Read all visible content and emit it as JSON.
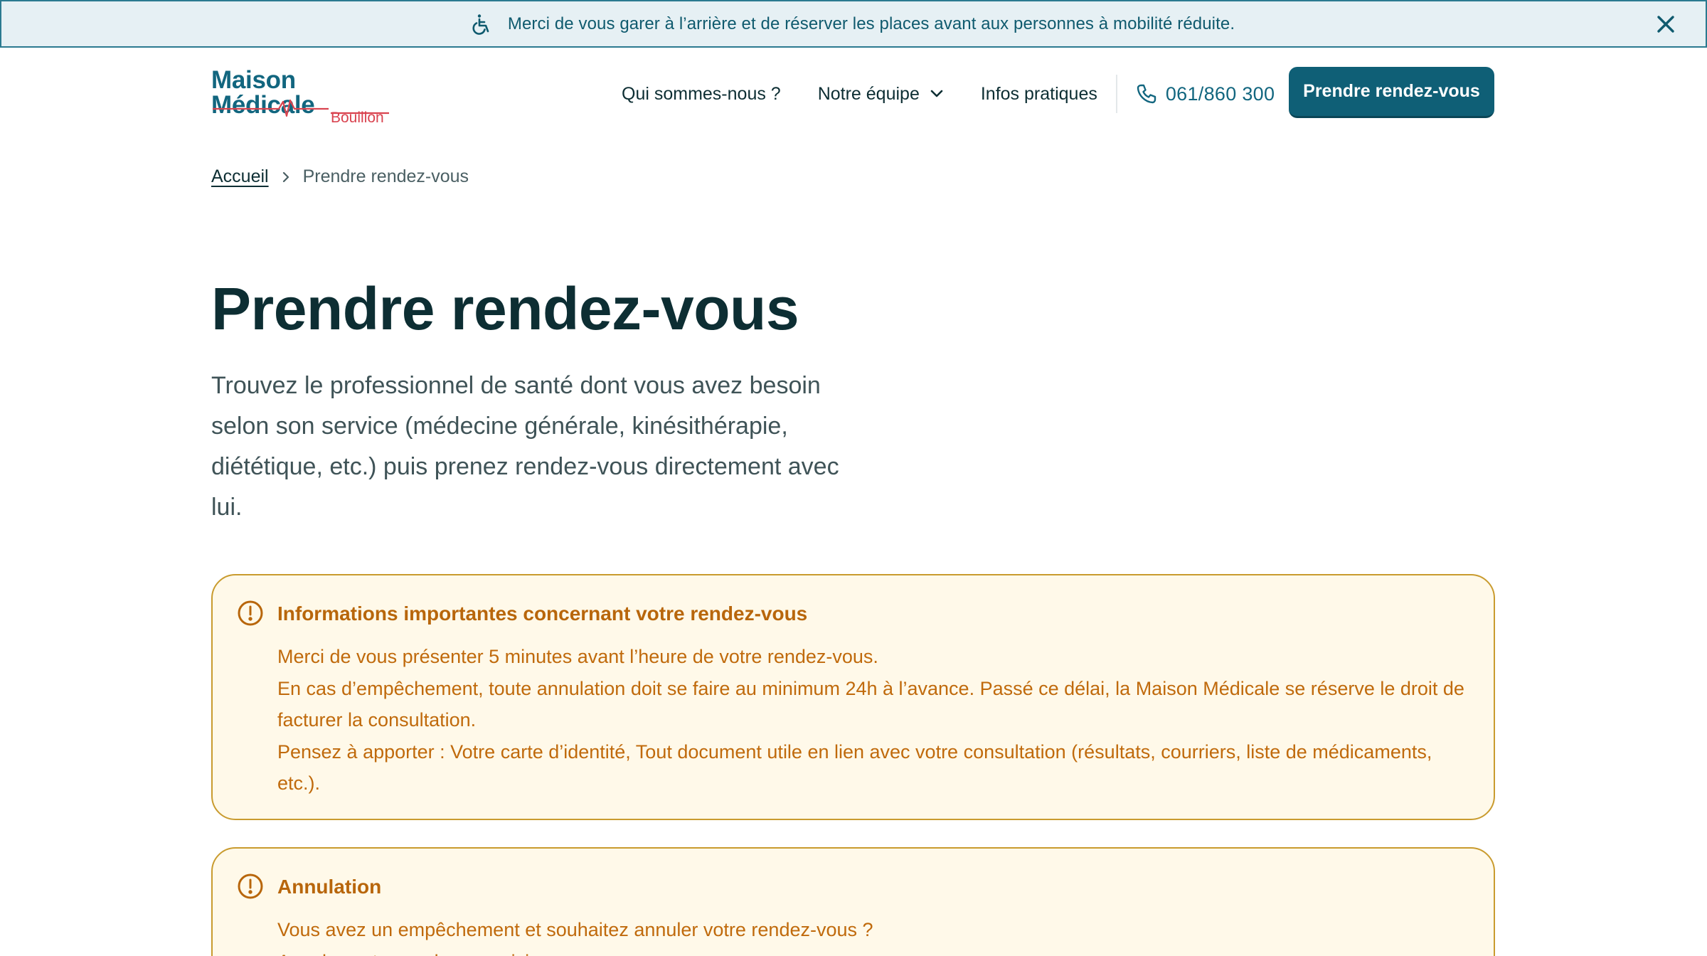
{
  "notice": {
    "text": "Merci de vous garer à l’arrière et de réserver les places avant aux personnes à mobilité réduite.",
    "icon": "wheelchair-icon",
    "close_icon": "close-icon"
  },
  "header": {
    "logo_main": "Maison Médicale",
    "logo_sub": "Bouillon",
    "nav": [
      {
        "label": "Qui sommes-nous ?"
      },
      {
        "label": "Notre équipe",
        "has_dropdown": true
      },
      {
        "label": "Infos pratiques"
      }
    ],
    "phone": "061/860 300",
    "cta_label": "Prendre rendez-vous"
  },
  "breadcrumb": {
    "home": "Accueil",
    "current": "Prendre rendez-vous"
  },
  "main": {
    "title": "Prendre rendez-vous",
    "intro": "Trouvez le professionnel de santé dont vous avez besoin selon son service (médecine générale, kinésithérapie, diététique, etc.) puis prenez rendez-vous directement avec lui."
  },
  "cards": [
    {
      "title": "Informations importantes concernant votre rendez-vous",
      "lines": [
        "Merci de vous présenter 5 minutes avant l’heure de votre rendez-vous.",
        "En cas d’empêchement, toute annulation doit se faire au minimum 24h à l’avance. Passé ce délai, la Maison Médicale se réserve le droit de facturer la consultation.",
        "Pensez à apporter : Votre carte d’identité, Tout document utile en lien avec votre consultation (résultats, courriers, liste de médicaments, etc.)."
      ]
    },
    {
      "title": "Annulation",
      "lines": [
        "Vous avez un empêchement et souhaitez annuler votre rendez-vous ?",
        "Annulez votre rendez-vous ici."
      ]
    }
  ],
  "colors": {
    "brand": "#12667f",
    "cta": "#0f5f76",
    "warning_text": "#c06a0c",
    "warning_bg": "#fff9e9",
    "warning_border": "#c99b2e",
    "logo_accent": "#d9434f"
  }
}
